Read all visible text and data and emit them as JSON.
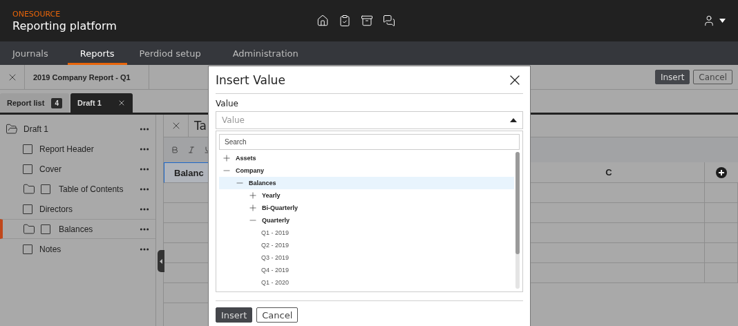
{
  "header": {
    "brand": "ONESOURCE",
    "title": "Reporting platform"
  },
  "nav": [
    {
      "label": "Journals",
      "selected": false
    },
    {
      "label": "Reports",
      "selected": true
    },
    {
      "label": "Perdiod setup",
      "selected": false
    },
    {
      "label": "Administration",
      "selected": false
    }
  ],
  "toolbar": {
    "report_title": "2019 Company Report - Q1",
    "buttons": [
      {
        "label": "Insert",
        "kind": "primary"
      },
      {
        "label": "Cancel",
        "kind": "secondary"
      }
    ]
  },
  "doc_tabs": [
    {
      "label": "Report list",
      "badge": "4",
      "selected": false,
      "closable": false
    },
    {
      "label": "Draft 1",
      "selected": true,
      "closable": true
    }
  ],
  "sidebar": {
    "root": "Draft 1",
    "items": [
      {
        "label": "Report Header",
        "kind": "page",
        "selected": false
      },
      {
        "label": "Cover",
        "kind": "page",
        "selected": false
      },
      {
        "label": "Table of Contents",
        "kind": "folder",
        "selected": false
      },
      {
        "label": "Directors",
        "kind": "page",
        "selected": false
      },
      {
        "label": "Balances",
        "kind": "folder",
        "selected": true
      },
      {
        "label": "Notes",
        "kind": "page",
        "selected": false
      }
    ]
  },
  "editor": {
    "title": "Ta",
    "columns": [
      {
        "label": "Balanc",
        "selected": true
      },
      {
        "label": "C",
        "selected": false
      }
    ]
  },
  "dialog": {
    "title": "Insert Value",
    "field_label": "Value",
    "placeholder": "Value",
    "expanded": true,
    "search_placeholder": "Search",
    "tree": [
      {
        "label": "Assets",
        "expanded": false,
        "selected": false
      },
      {
        "label": "Company",
        "expanded": true,
        "selected": false,
        "children": [
          {
            "label": "Balances",
            "expanded": true,
            "selected": true,
            "children": [
              {
                "label": "Yearly",
                "expanded": false,
                "selected": false
              },
              {
                "label": "Bi-Quarterly",
                "expanded": false,
                "selected": false
              },
              {
                "label": "Quarterly",
                "expanded": true,
                "selected": false,
                "children": [
                  {
                    "label": "Q1 - 2019",
                    "selected": false
                  },
                  {
                    "label": "Q2 - 2019",
                    "selected": false
                  },
                  {
                    "label": "Q3 - 2019",
                    "selected": false
                  },
                  {
                    "label": "Q4 - 2019",
                    "selected": false
                  },
                  {
                    "label": "Q1 - 2020",
                    "selected": false
                  }
                ]
              }
            ]
          }
        ]
      }
    ],
    "buttons": [
      {
        "label": "Insert",
        "kind": "primary"
      },
      {
        "label": "Cancel",
        "kind": "secondary"
      }
    ]
  }
}
